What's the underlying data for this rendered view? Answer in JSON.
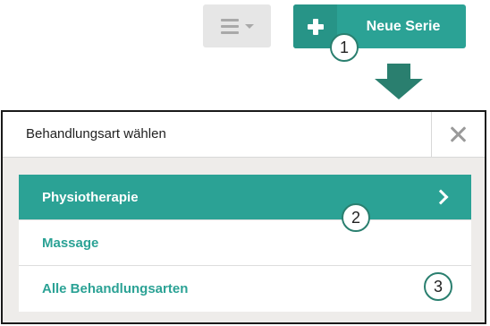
{
  "toolbar": {
    "menu_icon": "hamburger-menu-icon",
    "new_series_icon": "plus-icon",
    "new_series_label": "Neue Serie"
  },
  "steps": [
    "1",
    "2",
    "3"
  ],
  "dialog": {
    "title": "Behandlungsart wählen",
    "close_icon": "close-icon",
    "options": [
      {
        "label": "Physiotherapie",
        "active": true,
        "icon": "chevron-right-icon"
      },
      {
        "label": "Massage",
        "active": false
      },
      {
        "label": "Alle Behandlungsarten",
        "active": false
      }
    ]
  },
  "colors": {
    "accent": "#2ba295",
    "accent_dark": "#279487",
    "arrow": "#2a7f6f",
    "menu_button_bg": "#e6e6e6",
    "dialog_body_bg": "#eeecea"
  }
}
